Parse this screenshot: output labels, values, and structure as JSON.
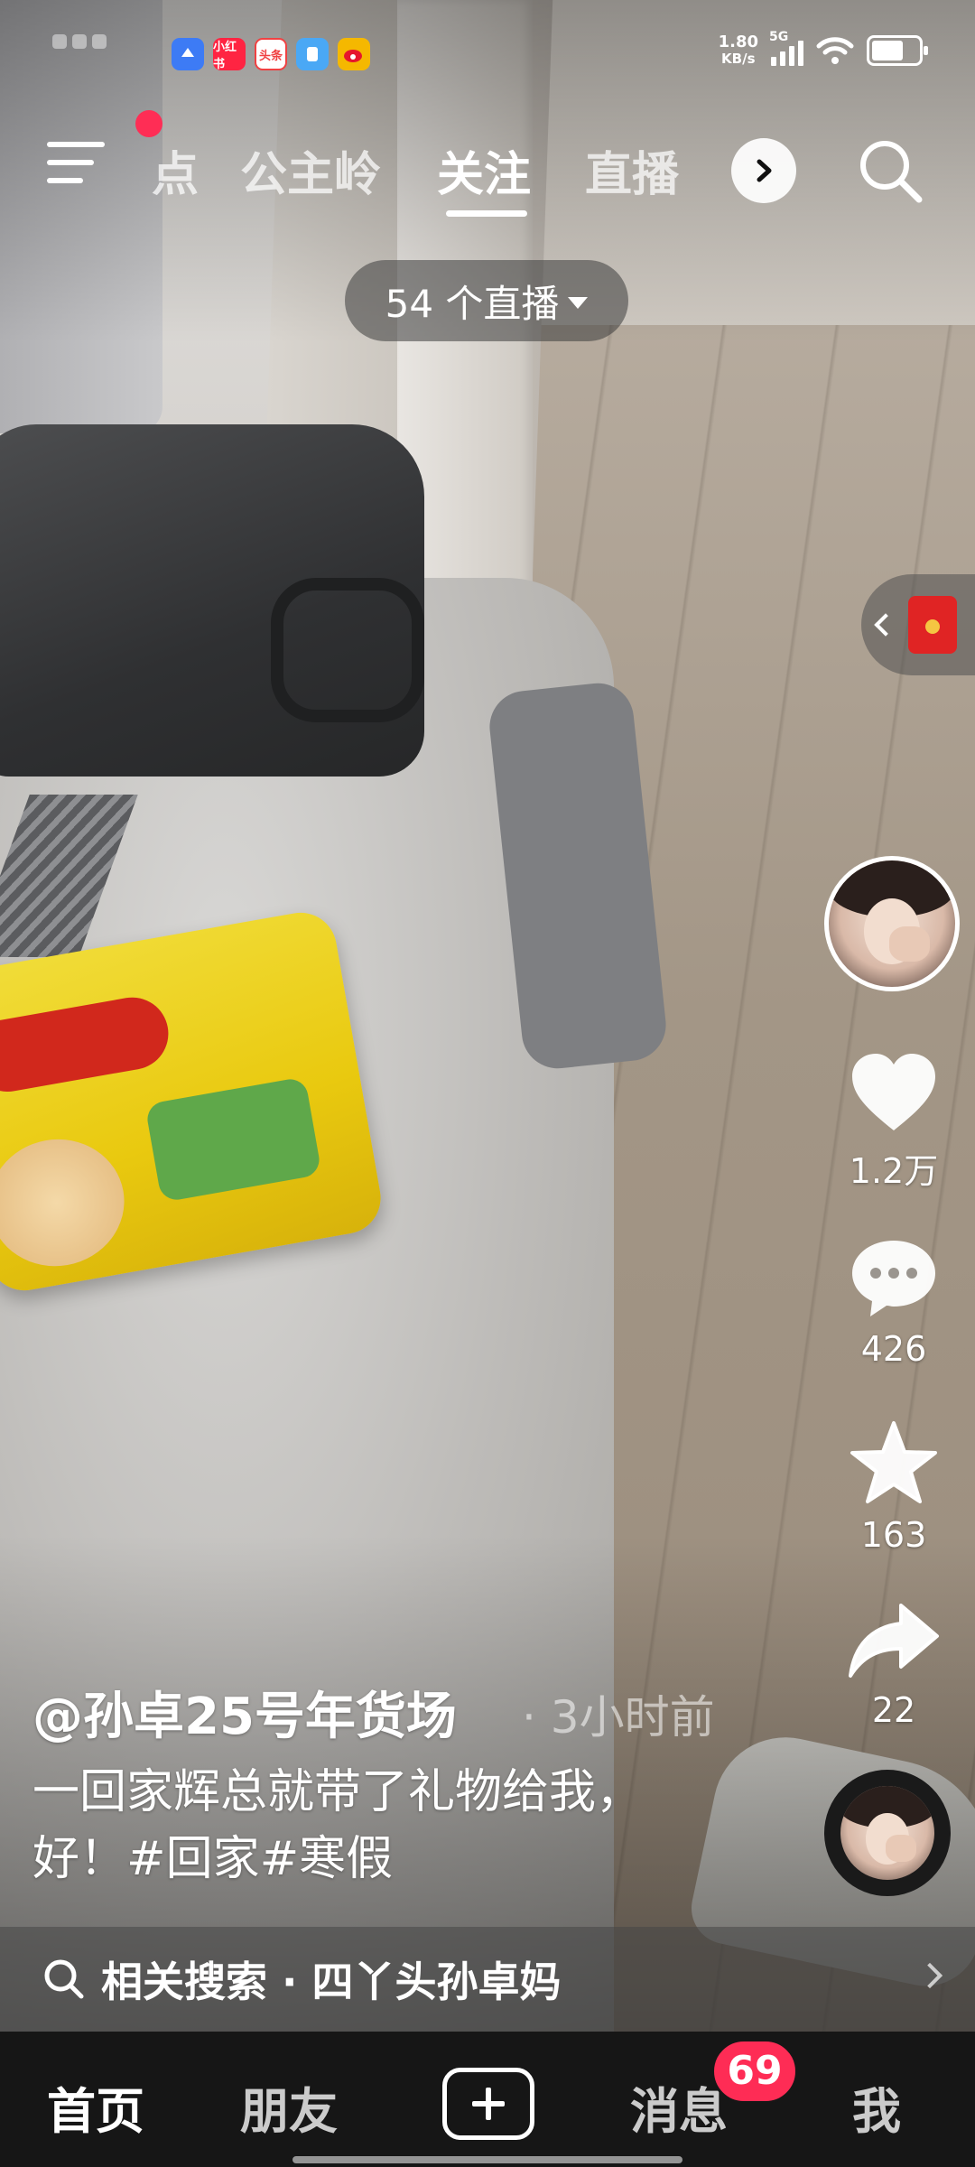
{
  "status_bar": {
    "net_speed_value": "1.80",
    "net_speed_unit": "KB/s",
    "network": "5G",
    "app_icons": [
      {
        "name": "app-icon-blue",
        "color": "#3d7bf5",
        "label": ""
      },
      {
        "name": "xiaohongshu-icon",
        "color": "#ff2442",
        "label": "小红书"
      },
      {
        "name": "toutiao-icon",
        "color": "#f04142",
        "label": "头条"
      },
      {
        "name": "app-icon-lightblue",
        "color": "#4aa8f5",
        "label": ""
      },
      {
        "name": "weibo-icon",
        "color": "#f5b800",
        "label": ""
      }
    ]
  },
  "top_nav": {
    "tabs": [
      {
        "label": "点",
        "active": false
      },
      {
        "label": "公主岭",
        "active": false
      },
      {
        "label": "关注",
        "active": true
      },
      {
        "label": "直播",
        "active": false
      }
    ]
  },
  "live_pill": {
    "label": "54 个直播"
  },
  "actions": {
    "likes": "1.2万",
    "comments": "426",
    "favorites": "163",
    "shares": "22"
  },
  "post": {
    "author": "@孙卓25号年货场",
    "time_ago": "· 3小时前",
    "caption": "一回家辉总就带了礼物给我，好！#回家#寒假"
  },
  "related_search": {
    "label": "相关搜索 · 四丫头孙卓妈"
  },
  "bottom_tabs": {
    "home": "首页",
    "friends": "朋友",
    "messages": "消息",
    "messages_badge": "69",
    "me": "我"
  },
  "colors": {
    "accent": "#fe2c55",
    "tabbar_bg": "#161616"
  }
}
